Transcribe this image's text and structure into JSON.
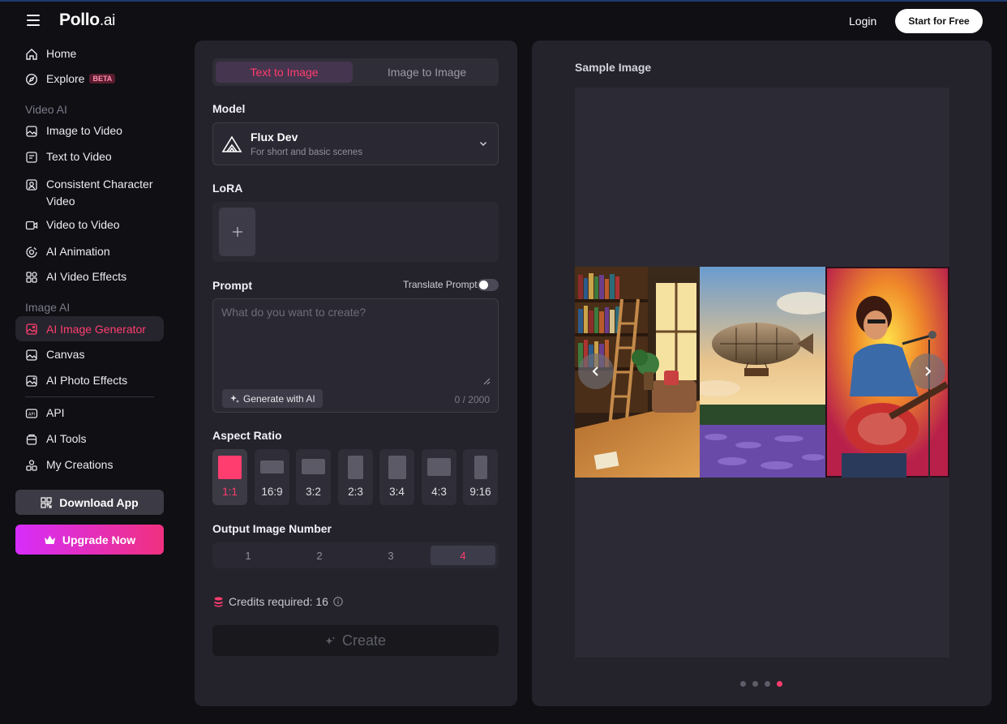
{
  "header": {
    "logo_main": "Pollo",
    "logo_suffix": ".ai",
    "login": "Login",
    "start_free": "Start for Free"
  },
  "sidebar": {
    "home": "Home",
    "explore": "Explore",
    "explore_badge": "BETA",
    "video_section": "Video AI",
    "video_items": [
      "Image to Video",
      "Text to Video",
      "Consistent Character Video",
      "Video to Video",
      "AI Animation",
      "AI Video Effects"
    ],
    "image_section": "Image AI",
    "image_items": [
      "AI Image Generator",
      "Canvas",
      "AI Photo Effects"
    ],
    "other_items": [
      "API",
      "AI Tools",
      "My Creations"
    ],
    "download_app": "Download App",
    "upgrade_now": "Upgrade Now"
  },
  "form": {
    "tabs": [
      "Text to Image",
      "Image to Image"
    ],
    "active_tab": "Text to Image",
    "model_label": "Model",
    "model_name": "Flux Dev",
    "model_desc": "For short and basic scenes",
    "lora_label": "LoRA",
    "prompt_label": "Prompt",
    "translate_prompt": "Translate Prompt",
    "translate_enabled": false,
    "prompt_placeholder": "What do you want to create?",
    "generate_with_ai": "Generate with AI",
    "char_count": "0 / 2000",
    "aspect_label": "Aspect Ratio",
    "aspect_ratios": [
      "1:1",
      "16:9",
      "3:2",
      "2:3",
      "3:4",
      "4:3",
      "9:16"
    ],
    "aspect_selected": "1:1",
    "output_label": "Output Image Number",
    "output_numbers": [
      "1",
      "2",
      "3",
      "4"
    ],
    "output_selected": "4",
    "credits_text": "Credits required: 16",
    "create": "Create"
  },
  "preview": {
    "title": "Sample Image",
    "slide_count": 4,
    "active_slide": 4
  },
  "colors": {
    "accent": "#ff3d6e",
    "background": "#0f0f14",
    "panel": "#24232c",
    "upgrade_gradient_start": "#d62dfb",
    "upgrade_gradient_end": "#f0307f"
  }
}
